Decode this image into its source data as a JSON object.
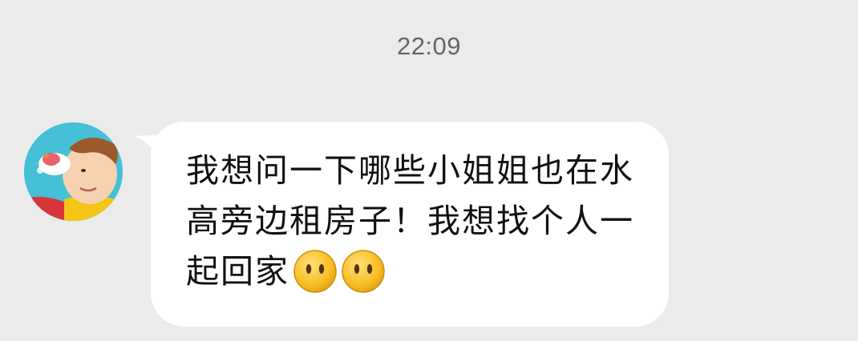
{
  "chat": {
    "timestamp": "22:09",
    "message": {
      "text": "我想问一下哪些小姐姐也在水高旁边租房子！我想找个人一起回家",
      "emojis": [
        "speechless-face-icon",
        "speechless-face-icon"
      ]
    },
    "avatar_icon": "cartoon-boy-avatar"
  },
  "colors": {
    "background": "#ebebeb",
    "bubble": "#ffffff",
    "timestamp": "#666666",
    "text": "#111111",
    "emoji": "#f5b81c"
  }
}
